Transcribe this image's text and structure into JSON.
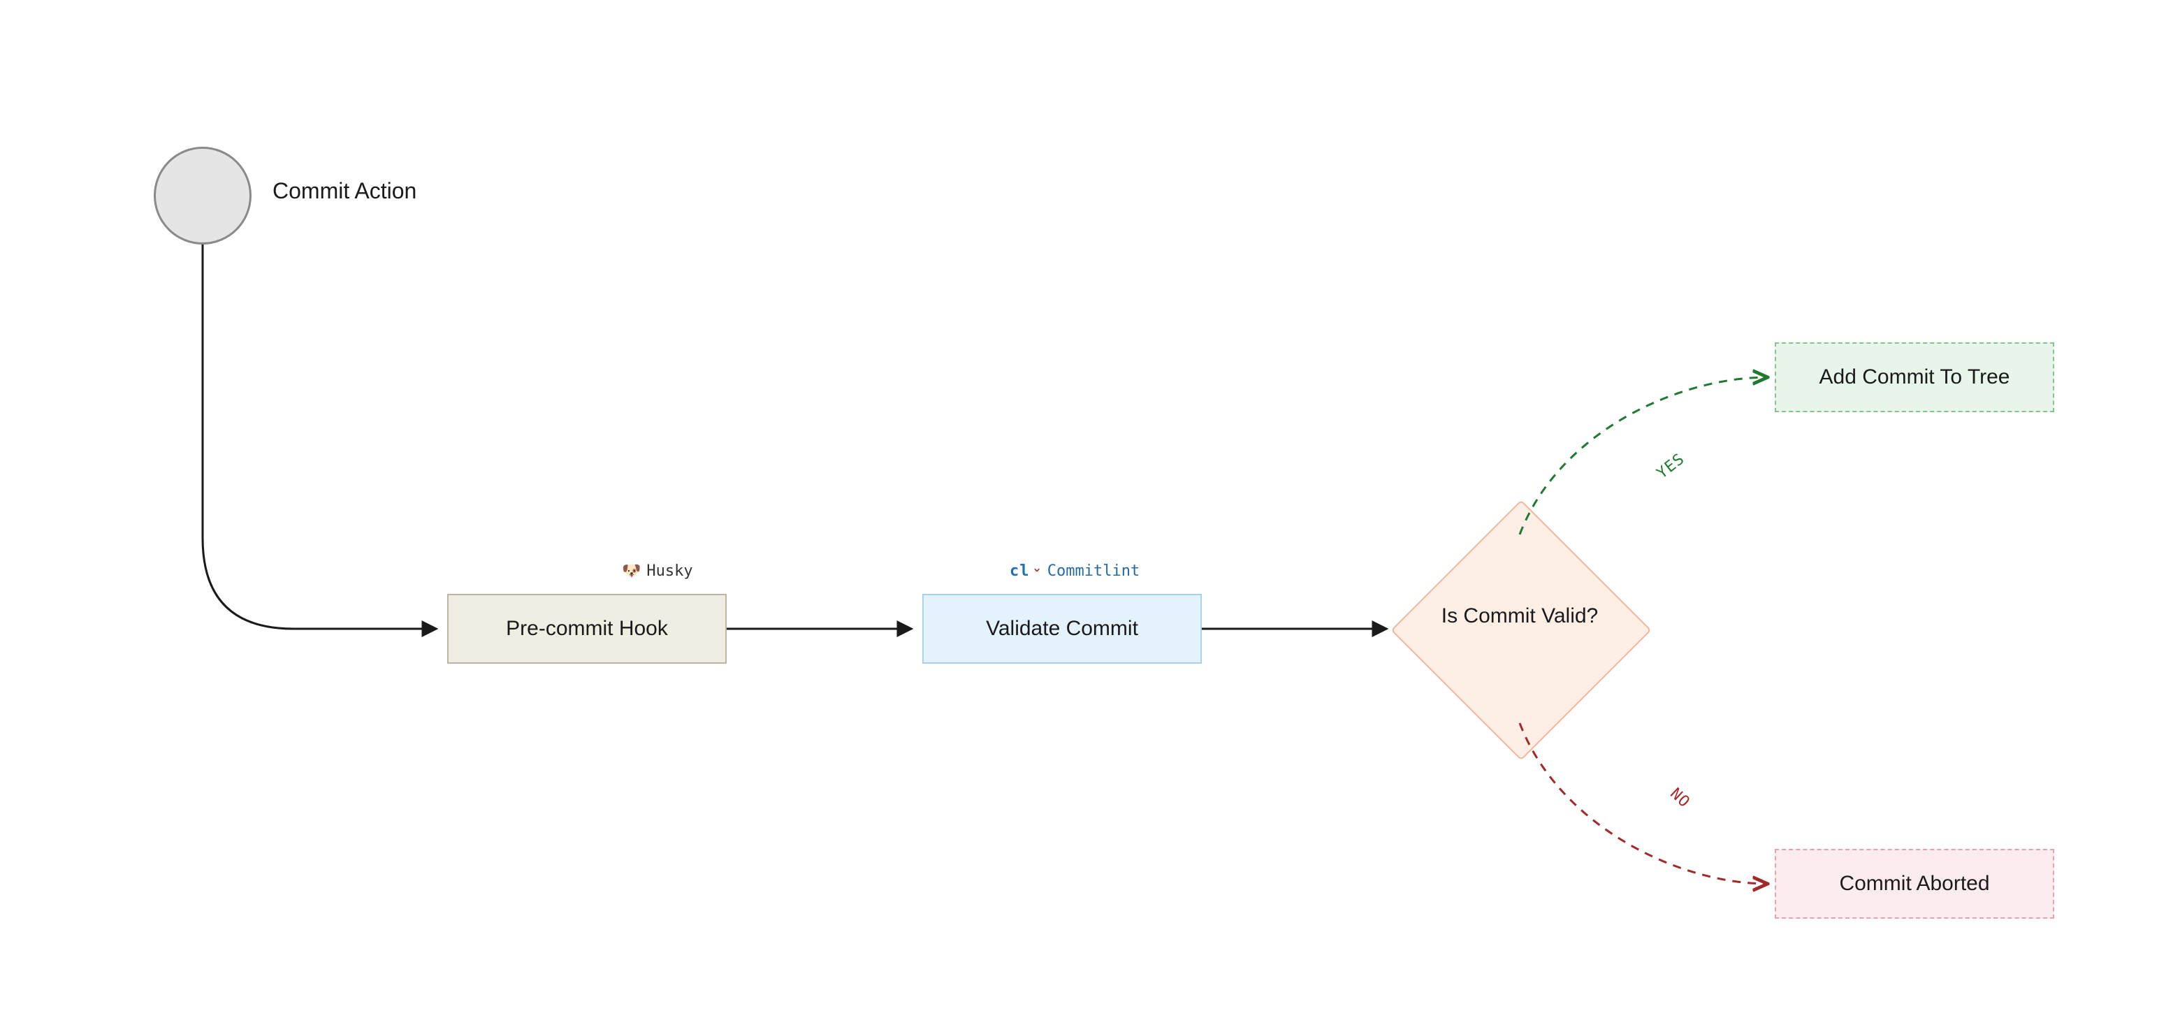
{
  "nodes": {
    "start": {
      "label": "Commit Action"
    },
    "precommit": {
      "label": "Pre-commit Hook",
      "badge": "Husky",
      "badge_icon": "🐶"
    },
    "validate": {
      "label": "Validate Commit",
      "badge_cl": "cl",
      "badge_caret": "ˇ",
      "badge_name": "Commitlint"
    },
    "decision": {
      "label": "Is Commit Valid?"
    },
    "addtree": {
      "label": "Add Commit To Tree"
    },
    "aborted": {
      "label": "Commit Aborted"
    }
  },
  "edges": {
    "yes": "YES",
    "no": "NO"
  }
}
